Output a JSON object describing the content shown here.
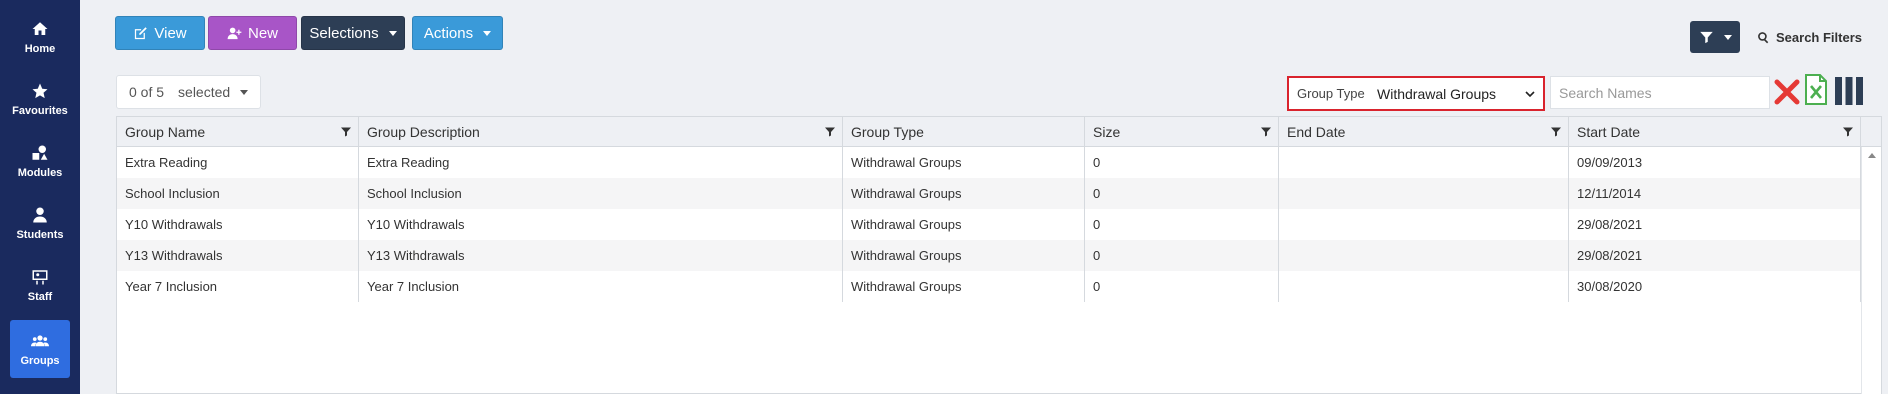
{
  "sidebar": {
    "items": [
      {
        "label": "Home",
        "icon": "home-icon"
      },
      {
        "label": "Favourites",
        "icon": "star-icon"
      },
      {
        "label": "Modules",
        "icon": "modules-icon"
      },
      {
        "label": "Students",
        "icon": "student-icon"
      },
      {
        "label": "Staff",
        "icon": "staff-icon"
      },
      {
        "label": "Groups",
        "icon": "groups-icon",
        "active": true
      }
    ]
  },
  "toolbar": {
    "view_label": "View",
    "new_label": "New",
    "selections_label": "Selections",
    "actions_label": "Actions",
    "search_filters_label": "Search Filters"
  },
  "selection": {
    "count": "0 of 5",
    "label": "selected"
  },
  "filter": {
    "group_type_label": "Group Type",
    "group_type_value": "Withdrawal Groups",
    "search_placeholder": "Search Names"
  },
  "table": {
    "columns": [
      "Group Name",
      "Group Description",
      "Group Type",
      "Size",
      "End Date",
      "Start Date"
    ],
    "rows": [
      [
        "Extra Reading",
        "Extra Reading",
        "Withdrawal Groups",
        "0",
        "",
        "09/09/2013"
      ],
      [
        "School Inclusion",
        "School Inclusion",
        "Withdrawal Groups",
        "0",
        "",
        "12/11/2014"
      ],
      [
        "Y10 Withdrawals",
        "Y10 Withdrawals",
        "Withdrawal Groups",
        "0",
        "",
        "29/08/2021"
      ],
      [
        "Y13 Withdrawals",
        "Y13 Withdrawals",
        "Withdrawal Groups",
        "0",
        "",
        "29/08/2021"
      ],
      [
        "Year 7 Inclusion",
        "Year 7 Inclusion",
        "Withdrawal Groups",
        "0",
        "",
        "30/08/2020"
      ]
    ]
  },
  "colors": {
    "sidebar_bg": "#1a2a5e",
    "active_nav": "#2f6de0",
    "view_button": "#3a9ad9",
    "new_button": "#a855c7",
    "selections_button": "#2d3e55",
    "actions_button": "#3a9ad9",
    "highlight_border": "#d9232d"
  }
}
